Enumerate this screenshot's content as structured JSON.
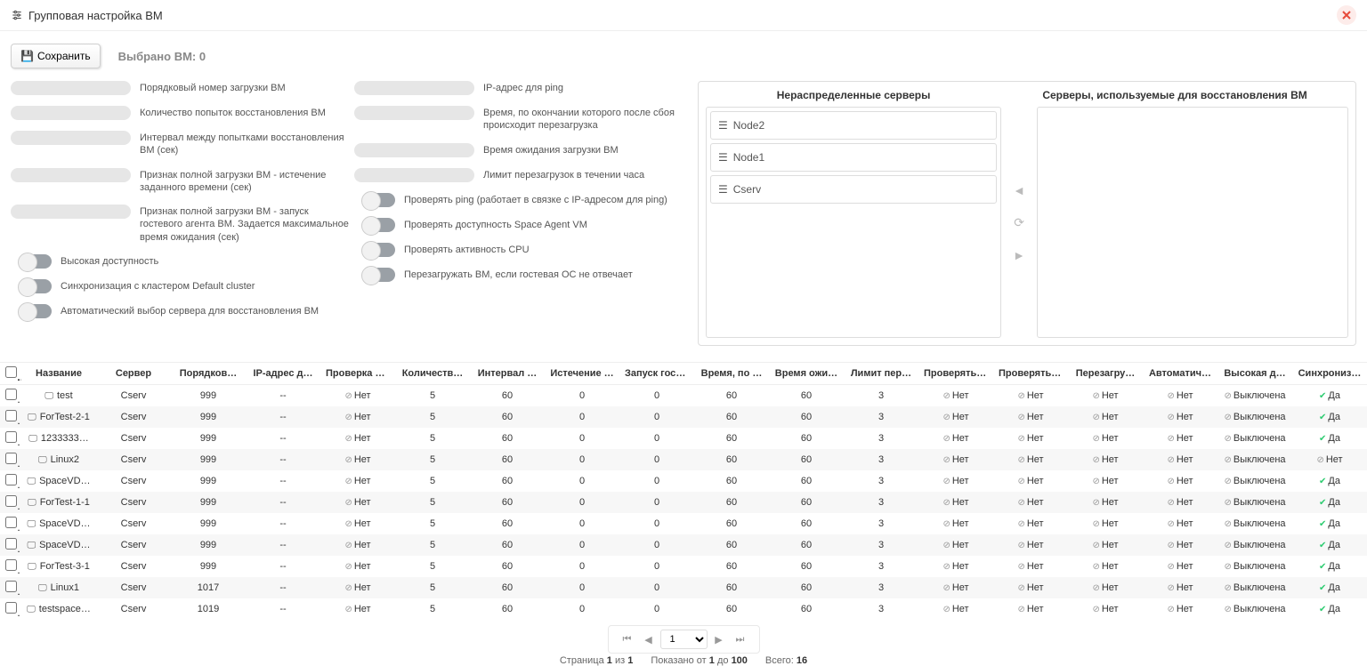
{
  "header": {
    "title": "Групповая настройка ВМ"
  },
  "toolbar": {
    "save_label": "Сохранить",
    "selected_label": "Выбрано ВМ: 0"
  },
  "fields_left": [
    {
      "label": "Порядковый номер загрузки ВМ"
    },
    {
      "label": "Количество попыток восстановления ВМ"
    },
    {
      "label": "Интервал между попытками восстановления ВМ (сек)"
    },
    {
      "label": "Признак полной загрузки ВМ - истечение заданного времени (сек)"
    },
    {
      "label": "Признак полной загрузки ВМ - запуск гостевого агента ВМ. Задается максимальное время ожидания (сек)"
    }
  ],
  "fields_right": [
    {
      "label": "IP-адрес для ping"
    },
    {
      "label": "Время, по окончании которого после сбоя происходит перезагрузка"
    },
    {
      "label": "Время ожидания загрузки ВМ"
    },
    {
      "label": "Лимит перезагрузок в течении часа"
    }
  ],
  "toggles_left": [
    {
      "label": "Высокая доступность"
    },
    {
      "label": "Синхронизация с кластером Default cluster"
    },
    {
      "label": "Автоматический выбор сервера для восстановления ВМ"
    }
  ],
  "toggles_right": [
    {
      "label": "Проверять ping (работает в связке с IP-адресом для ping)"
    },
    {
      "label": "Проверять доступность Space Agent VM"
    },
    {
      "label": "Проверять активность CPU"
    },
    {
      "label": "Перезагружать ВМ, если гостевая ОС не отвечает"
    }
  ],
  "servers": {
    "left_header": "Нераспределенные серверы",
    "right_header": "Серверы, используемые для восстановления ВМ",
    "items": [
      "Node2",
      "Node1",
      "Cserv"
    ]
  },
  "table": {
    "headers": [
      "",
      "Название",
      "Сервер",
      "Порядков…",
      "IP-адрес д…",
      "Проверка p…",
      "Количеств…",
      "Интервал …",
      "Истечение …",
      "Запуск гост…",
      "Время, по …",
      "Время ожи…",
      "Лимит пер…",
      "Проверять …",
      "Проверять …",
      "Перезагру…",
      "Автоматич…",
      "Высокая д…",
      "Синхрониз…"
    ],
    "no_label": "Нет",
    "yes_label": "Да",
    "off_label": "Выключена",
    "rows": [
      {
        "name": "test",
        "server": "Cserv",
        "ord": "999",
        "ip": "--",
        "chk": "no",
        "cnt": "5",
        "intv": "60",
        "exp": "0",
        "gst": "0",
        "tafter": "60",
        "twait": "60",
        "lim": "3",
        "p1": "no",
        "p2": "no",
        "p3": "no",
        "p4": "no",
        "ha": "off",
        "sync": "yes"
      },
      {
        "name": "ForTest-2-1",
        "server": "Cserv",
        "ord": "999",
        "ip": "--",
        "chk": "no",
        "cnt": "5",
        "intv": "60",
        "exp": "0",
        "gst": "0",
        "tafter": "60",
        "twait": "60",
        "lim": "3",
        "p1": "no",
        "p2": "no",
        "p3": "no",
        "p4": "no",
        "ha": "off",
        "sync": "yes"
      },
      {
        "name": "1233333…",
        "server": "Cserv",
        "ord": "999",
        "ip": "--",
        "chk": "no",
        "cnt": "5",
        "intv": "60",
        "exp": "0",
        "gst": "0",
        "tafter": "60",
        "twait": "60",
        "lim": "3",
        "p1": "no",
        "p2": "no",
        "p3": "no",
        "p4": "no",
        "ha": "off",
        "sync": "yes"
      },
      {
        "name": "Linux2",
        "server": "Cserv",
        "ord": "999",
        "ip": "--",
        "chk": "no",
        "cnt": "5",
        "intv": "60",
        "exp": "0",
        "gst": "0",
        "tafter": "60",
        "twait": "60",
        "lim": "3",
        "p1": "no",
        "p2": "no",
        "p3": "no",
        "p4": "no",
        "ha": "off",
        "sync": "no"
      },
      {
        "name": "SpaceVD…",
        "server": "Cserv",
        "ord": "999",
        "ip": "--",
        "chk": "no",
        "cnt": "5",
        "intv": "60",
        "exp": "0",
        "gst": "0",
        "tafter": "60",
        "twait": "60",
        "lim": "3",
        "p1": "no",
        "p2": "no",
        "p3": "no",
        "p4": "no",
        "ha": "off",
        "sync": "yes"
      },
      {
        "name": "ForTest-1-1",
        "server": "Cserv",
        "ord": "999",
        "ip": "--",
        "chk": "no",
        "cnt": "5",
        "intv": "60",
        "exp": "0",
        "gst": "0",
        "tafter": "60",
        "twait": "60",
        "lim": "3",
        "p1": "no",
        "p2": "no",
        "p3": "no",
        "p4": "no",
        "ha": "off",
        "sync": "yes"
      },
      {
        "name": "SpaceVD…",
        "server": "Cserv",
        "ord": "999",
        "ip": "--",
        "chk": "no",
        "cnt": "5",
        "intv": "60",
        "exp": "0",
        "gst": "0",
        "tafter": "60",
        "twait": "60",
        "lim": "3",
        "p1": "no",
        "p2": "no",
        "p3": "no",
        "p4": "no",
        "ha": "off",
        "sync": "yes"
      },
      {
        "name": "SpaceVD…",
        "server": "Cserv",
        "ord": "999",
        "ip": "--",
        "chk": "no",
        "cnt": "5",
        "intv": "60",
        "exp": "0",
        "gst": "0",
        "tafter": "60",
        "twait": "60",
        "lim": "3",
        "p1": "no",
        "p2": "no",
        "p3": "no",
        "p4": "no",
        "ha": "off",
        "sync": "yes"
      },
      {
        "name": "ForTest-3-1",
        "server": "Cserv",
        "ord": "999",
        "ip": "--",
        "chk": "no",
        "cnt": "5",
        "intv": "60",
        "exp": "0",
        "gst": "0",
        "tafter": "60",
        "twait": "60",
        "lim": "3",
        "p1": "no",
        "p2": "no",
        "p3": "no",
        "p4": "no",
        "ha": "off",
        "sync": "yes"
      },
      {
        "name": "Linux1",
        "server": "Cserv",
        "ord": "1017",
        "ip": "--",
        "chk": "no",
        "cnt": "5",
        "intv": "60",
        "exp": "0",
        "gst": "0",
        "tafter": "60",
        "twait": "60",
        "lim": "3",
        "p1": "no",
        "p2": "no",
        "p3": "no",
        "p4": "no",
        "ha": "off",
        "sync": "yes"
      },
      {
        "name": "testspace…",
        "server": "Cserv",
        "ord": "1019",
        "ip": "--",
        "chk": "no",
        "cnt": "5",
        "intv": "60",
        "exp": "0",
        "gst": "0",
        "tafter": "60",
        "twait": "60",
        "lim": "3",
        "p1": "no",
        "p2": "no",
        "p3": "no",
        "p4": "no",
        "ha": "off",
        "sync": "yes"
      }
    ]
  },
  "pager": {
    "page_options": [
      "1"
    ],
    "page_prefix": "Страница ",
    "page_current": "1",
    "page_of": " из ",
    "page_total": "1",
    "shown_prefix": "Показано от ",
    "shown_from": "1",
    "shown_to_word": " до ",
    "shown_to": "100",
    "total_prefix": "Всего: ",
    "total": "16"
  }
}
